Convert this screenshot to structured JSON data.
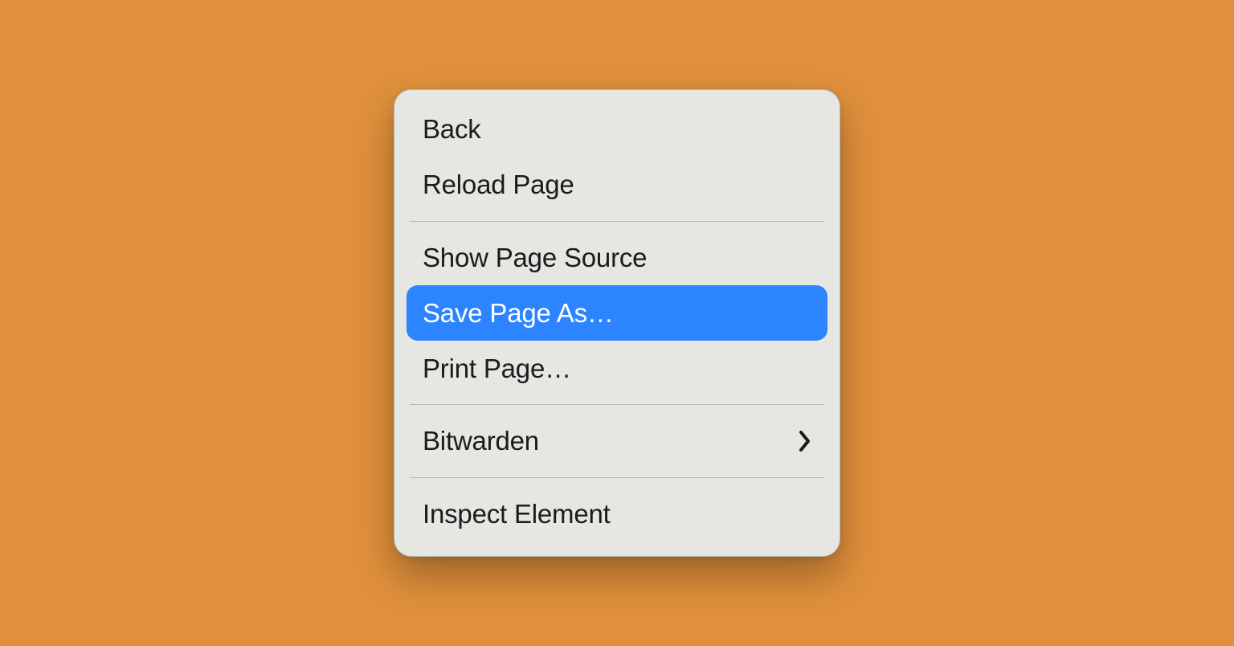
{
  "menu": {
    "groups": [
      {
        "items": [
          {
            "id": "back",
            "label": "Back",
            "submenu": false,
            "highlighted": false
          },
          {
            "id": "reload-page",
            "label": "Reload Page",
            "submenu": false,
            "highlighted": false
          }
        ]
      },
      {
        "items": [
          {
            "id": "show-page-source",
            "label": "Show Page Source",
            "submenu": false,
            "highlighted": false
          },
          {
            "id": "save-page-as",
            "label": "Save Page As…",
            "submenu": false,
            "highlighted": true
          },
          {
            "id": "print-page",
            "label": "Print Page…",
            "submenu": false,
            "highlighted": false
          }
        ]
      },
      {
        "items": [
          {
            "id": "bitwarden",
            "label": "Bitwarden",
            "submenu": true,
            "highlighted": false
          }
        ]
      },
      {
        "items": [
          {
            "id": "inspect-element",
            "label": "Inspect Element",
            "submenu": false,
            "highlighted": false
          }
        ]
      }
    ]
  },
  "colors": {
    "page_background": "#e0903b",
    "menu_background": "#e6e6e3",
    "highlight": "#2c84ff",
    "text": "#1b1b1b",
    "separator": "#b6b6b2"
  }
}
